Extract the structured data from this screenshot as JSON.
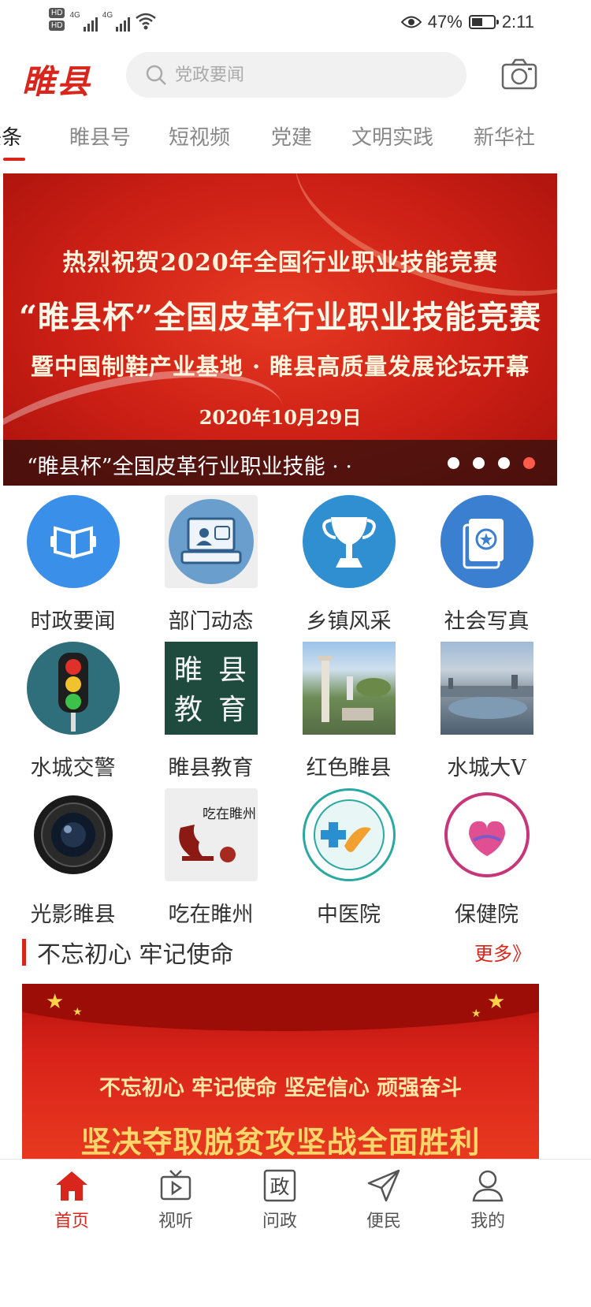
{
  "status_bar": {
    "battery_percent": "47%",
    "time": "2:11",
    "network_labels": [
      "HD",
      "HD",
      "4G",
      "4G"
    ]
  },
  "header": {
    "logo_text": "睢县",
    "search_placeholder": "党政要闻"
  },
  "tabs": [
    {
      "label": "头条",
      "active": true
    },
    {
      "label": "睢县号"
    },
    {
      "label": "短视频"
    },
    {
      "label": "党建"
    },
    {
      "label": "文明实践"
    },
    {
      "label": "新华社"
    }
  ],
  "banner": {
    "line1": "热烈祝贺2020年全国行业职业技能竞赛",
    "line2": "“睢县杯”全国皮革行业职业技能竞赛",
    "line3": "暨中国制鞋产业基地 · 睢县高质量发展论坛开幕",
    "line4": "2020年10月29日",
    "caption": "“睢县杯”全国皮革行业职业技能 · ·",
    "dots_total": 4,
    "dots_active_index": 3
  },
  "grid": [
    {
      "label": "时政要闻",
      "icon": "book-icon"
    },
    {
      "label": "部门动态",
      "icon": "computer-icon"
    },
    {
      "label": "乡镇风采",
      "icon": "trophy-icon"
    },
    {
      "label": "社会写真",
      "icon": "photo-book-icon"
    },
    {
      "label": "水城交警",
      "icon": "traffic-light-icon"
    },
    {
      "label": "睢县教育",
      "icon": "blackboard-icon",
      "icon_text": [
        "睢",
        "县",
        "教",
        "育"
      ]
    },
    {
      "label": "红色睢县",
      "icon": "monument-photo"
    },
    {
      "label": "水城大V",
      "icon": "city-lake-photo"
    },
    {
      "label": "光影睢县",
      "icon": "camera-lens-icon"
    },
    {
      "label": "吃在睢州",
      "icon": "food-calligraphy-icon",
      "icon_text": "吃在睢州"
    },
    {
      "label": "中医院",
      "icon": "hospital-logo-icon"
    },
    {
      "label": "保健院",
      "icon": "maternal-health-logo-icon"
    }
  ],
  "section": {
    "title": "不忘初心 牢记使命",
    "more_label": "更多》"
  },
  "poster": {
    "line1": "不忘初心 牢记使命 坚定信心 顽强奋斗",
    "line2": "坚决夺取脱贫攻坚战全面胜利"
  },
  "bottom_nav": [
    {
      "label": "首页",
      "icon": "home-icon",
      "active": true
    },
    {
      "label": "视听",
      "icon": "tv-play-icon"
    },
    {
      "label": "问政",
      "icon": "politics-icon",
      "icon_text": "政"
    },
    {
      "label": "便民",
      "icon": "paper-plane-icon"
    },
    {
      "label": "我的",
      "icon": "user-icon"
    }
  ],
  "colors": {
    "brand_red": "#d9261c",
    "banner_red": "#cc1f15",
    "blue_icon": "#3a8fe8"
  }
}
